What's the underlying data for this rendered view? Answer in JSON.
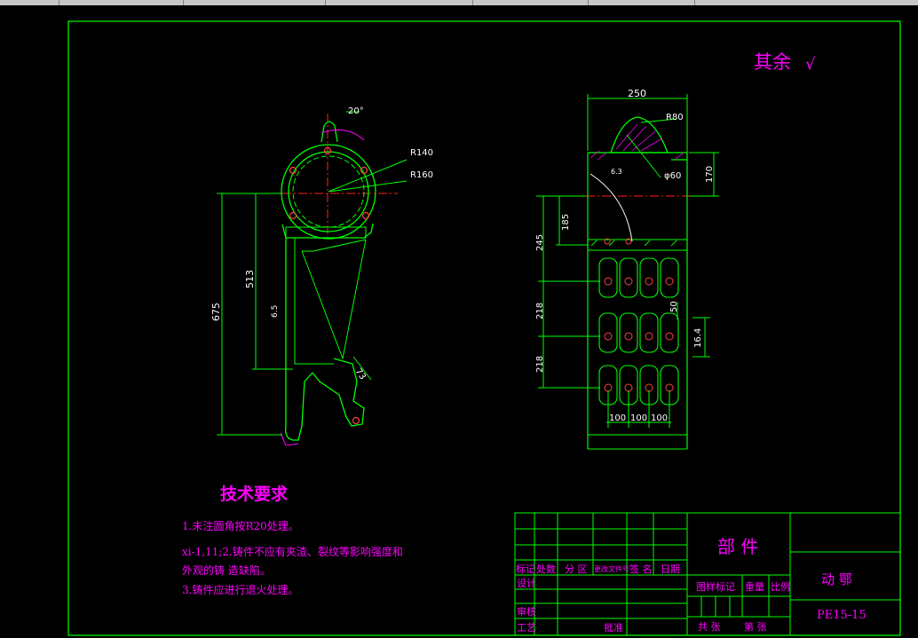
{
  "roughness": {
    "label": "其余",
    "symbol": "√"
  },
  "dims": {
    "d20": "20°",
    "r140": "R140",
    "r160": "R160",
    "d675": "675",
    "d513": "513",
    "d65": "6.5",
    "d73": "73",
    "d250": "250",
    "r80": "R80",
    "d170": "170",
    "phi60": "φ60",
    "d185": "185",
    "d245": "245",
    "d218a": "218",
    "d218b": "218",
    "d50": "50",
    "d164": "16.4",
    "d100a": "100",
    "d100b": "100",
    "d100c": "100",
    "d63": "6.3"
  },
  "notes": {
    "title": "技术要求",
    "line1": "1.未注圆角按R20处理。",
    "line2": "xi-1,11;2.铸件不应有夹渣、裂纹等影响强度和",
    "line3": "外观的铸   造缺陷。",
    "line4": "3.铸件应进行退火处理。"
  },
  "titleblock": {
    "part_label": "部  件",
    "name": "动  鄂",
    "code": "PE15-15",
    "h_mark": "标记",
    "h_count": "处数",
    "h_zone": "分 区",
    "h_doc": "更改文件号",
    "h_sign": "签 名",
    "h_date": "日期",
    "design": "设计",
    "review": "审核",
    "process": "工艺",
    "approve": "批准",
    "stage_mark": "图样标记",
    "weight": "重量",
    "scale": "比例",
    "total_sheets": "共  张",
    "sheet_no": "第  张"
  }
}
